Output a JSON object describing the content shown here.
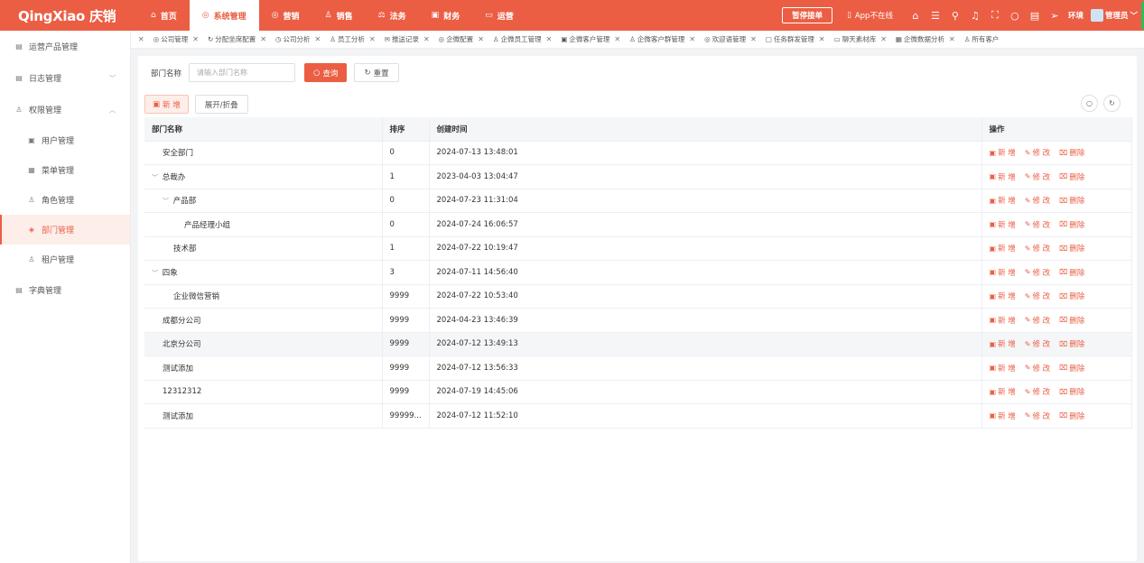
{
  "app": {
    "logo": "QingXiao 庆销"
  },
  "topnav": [
    {
      "icon": "⌂",
      "label": "首页",
      "active": false
    },
    {
      "icon": "◎",
      "label": "系统管理",
      "active": true
    },
    {
      "icon": "◎",
      "label": "营销",
      "active": false
    },
    {
      "icon": "♙",
      "label": "销售",
      "active": false
    },
    {
      "icon": "⚖",
      "label": "法务",
      "active": false
    },
    {
      "icon": "▣",
      "label": "财务",
      "active": false
    },
    {
      "icon": "▭",
      "label": "运营",
      "active": false
    }
  ],
  "topright": {
    "pause_label": "暂停接单",
    "app_status": "App不在线",
    "env_label": "环境",
    "user_label": "管理员"
  },
  "sidebar": {
    "items": [
      {
        "label": "运营产品管理",
        "icon": "▤",
        "sub": false,
        "arrow": ""
      },
      {
        "label": "日志管理",
        "icon": "▤",
        "sub": false,
        "arrow": "﹀"
      },
      {
        "label": "权限管理",
        "icon": "♙",
        "sub": false,
        "arrow": "︿"
      },
      {
        "label": "用户管理",
        "icon": "▣",
        "sub": true,
        "arrow": ""
      },
      {
        "label": "菜单管理",
        "icon": "▦",
        "sub": true,
        "arrow": ""
      },
      {
        "label": "角色管理",
        "icon": "♙",
        "sub": true,
        "arrow": ""
      },
      {
        "label": "部门管理",
        "icon": "◈",
        "sub": true,
        "arrow": "",
        "active": true
      },
      {
        "label": "租户管理",
        "icon": "♙",
        "sub": true,
        "arrow": ""
      },
      {
        "label": "字典管理",
        "icon": "▤",
        "sub": false,
        "arrow": ""
      }
    ]
  },
  "tabs": [
    {
      "icon": "◎",
      "label": "公司管理"
    },
    {
      "icon": "↻",
      "label": "分配坐席配置"
    },
    {
      "icon": "◷",
      "label": "公司分析"
    },
    {
      "icon": "♙",
      "label": "员工分析"
    },
    {
      "icon": "✉",
      "label": "推送记录"
    },
    {
      "icon": "◎",
      "label": "企微配置"
    },
    {
      "icon": "♙",
      "label": "企微员工管理"
    },
    {
      "icon": "▣",
      "label": "企微客户管理"
    },
    {
      "icon": "♙",
      "label": "企微客户群管理"
    },
    {
      "icon": "◎",
      "label": "欢迎语管理"
    },
    {
      "icon": "▢",
      "label": "任务群发管理"
    },
    {
      "icon": "▭",
      "label": "聊天素材库"
    },
    {
      "icon": "▦",
      "label": "企微数据分析"
    },
    {
      "icon": "♙",
      "label": "所有客户"
    }
  ],
  "search": {
    "label": "部门名称",
    "placeholder": "请输入部门名称",
    "query_label": "查询",
    "reset_label": "重置"
  },
  "actions": {
    "add_label": "新 增",
    "expand_label": "展开/折叠"
  },
  "table": {
    "headers": [
      "部门名称",
      "排序",
      "创建时间",
      "操作"
    ],
    "op_labels": {
      "add": "新 增",
      "edit": "修 改",
      "delete": "删除"
    },
    "rows": [
      {
        "name": "安全部门",
        "level": 1,
        "caret": "",
        "sort": "0",
        "created": "2024-07-13 13:48:01"
      },
      {
        "name": "总裁办",
        "level": 0,
        "caret": "﹀",
        "sort": "1",
        "created": "2023-04-03 13:04:47"
      },
      {
        "name": "产品部",
        "level": 1,
        "caret": "﹀",
        "sort": "0",
        "created": "2024-07-23 11:31:04"
      },
      {
        "name": "产品经理小组",
        "level": 3,
        "caret": "",
        "sort": "0",
        "created": "2024-07-24 16:06:57"
      },
      {
        "name": "技术部",
        "level": 2,
        "caret": "",
        "sort": "1",
        "created": "2024-07-22 10:19:47"
      },
      {
        "name": "四象",
        "level": 0,
        "caret": "﹀",
        "sort": "3",
        "created": "2024-07-11 14:56:40"
      },
      {
        "name": "企业微信营销",
        "level": 2,
        "caret": "",
        "sort": "9999",
        "created": "2024-07-22 10:53:40"
      },
      {
        "name": "成都分公司",
        "level": 1,
        "caret": "",
        "sort": "9999",
        "created": "2024-04-23 13:46:39"
      },
      {
        "name": "北京分公司",
        "level": 1,
        "caret": "",
        "sort": "9999",
        "created": "2024-07-12 13:49:13",
        "highlight": true
      },
      {
        "name": "测试添加",
        "level": 1,
        "caret": "",
        "sort": "9999",
        "created": "2024-07-12 13:56:33"
      },
      {
        "name": "12312312",
        "level": 1,
        "caret": "",
        "sort": "9999",
        "created": "2024-07-19 14:45:06"
      },
      {
        "name": "测试添加",
        "level": 1,
        "caret": "",
        "sort": "99999...",
        "created": "2024-07-12 11:52:10"
      }
    ]
  },
  "colors": {
    "brand": "#eb5e44",
    "online_indicator": "#2ebd59"
  }
}
